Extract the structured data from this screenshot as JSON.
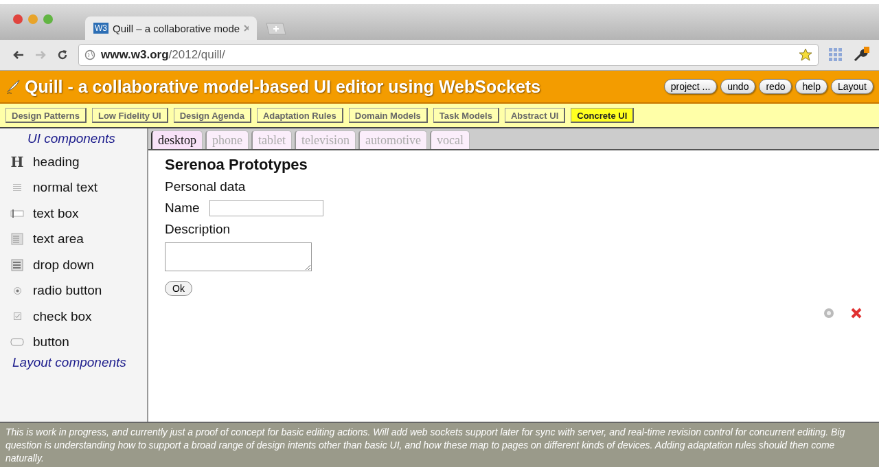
{
  "browser": {
    "tab_title": "Quill – a collaborative mode",
    "tab_favicon": "W3",
    "url_host": "www.w3.org",
    "url_path": "/2012/quill/"
  },
  "header": {
    "title": "Quill - a collaborative model-based UI editor using WebSockets",
    "buttons": [
      "project ...",
      "undo",
      "redo",
      "help",
      "Layout"
    ]
  },
  "nav": [
    {
      "label": "Design Patterns",
      "selected": false
    },
    {
      "label": "Low Fidelity UI",
      "selected": false
    },
    {
      "label": "Design Agenda",
      "selected": false
    },
    {
      "label": "Adaptation Rules",
      "selected": false
    },
    {
      "label": "Domain Models",
      "selected": false
    },
    {
      "label": "Task Models",
      "selected": false
    },
    {
      "label": "Abstract UI",
      "selected": false
    },
    {
      "label": "Concrete UI",
      "selected": true
    }
  ],
  "sidebar": {
    "title": "UI components",
    "items": [
      {
        "kind": "heading",
        "label": "heading",
        "glyph": "H"
      },
      {
        "kind": "text",
        "label": "normal text"
      },
      {
        "kind": "textbox",
        "label": "text box"
      },
      {
        "kind": "textarea",
        "label": "text area"
      },
      {
        "kind": "dropdown",
        "label": "drop down"
      },
      {
        "kind": "radio",
        "label": "radio button"
      },
      {
        "kind": "checkbox",
        "label": "check box"
      },
      {
        "kind": "button",
        "label": "button"
      }
    ],
    "footer_title": "Layout components"
  },
  "device_tabs": [
    {
      "label": "desktop",
      "selected": true
    },
    {
      "label": "phone",
      "selected": false
    },
    {
      "label": "tablet",
      "selected": false
    },
    {
      "label": "television",
      "selected": false
    },
    {
      "label": "automotive",
      "selected": false
    },
    {
      "label": "vocal",
      "selected": false
    }
  ],
  "canvas": {
    "heading": "Serenoa Prototypes",
    "section": "Personal data",
    "name_label": "Name",
    "description_label": "Description",
    "button": "Ok"
  },
  "status": "This is work in progress, and currently just a proof of concept for basic editing actions. Will add web sockets support later for sync with server, and real-time revision control for concurrent editing. Big question is understanding how to support a broad range of design intents other than basic UI, and how these map to pages on different kinds of devices. Adding adaptation rules should then come naturally."
}
